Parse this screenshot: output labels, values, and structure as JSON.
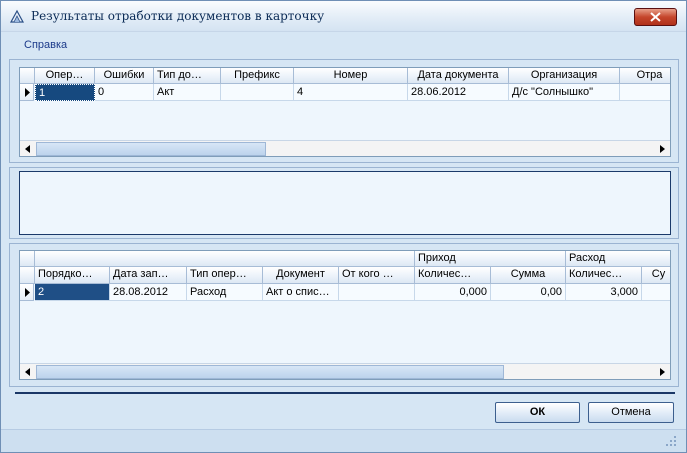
{
  "window": {
    "title": "Результаты отработки документов в карточку",
    "close_icon": "close-icon"
  },
  "menu": {
    "help": "Справка"
  },
  "top_grid": {
    "columns": [
      "Опер…",
      "Ошибки",
      "Тип до…",
      "Префикс",
      "Номер",
      "Дата документа",
      "Организация",
      "Отра"
    ],
    "rows": [
      [
        "1",
        "0",
        "Акт",
        "",
        "4",
        "28.06.2012",
        "Д/с \"Солнышко\"",
        ""
      ]
    ]
  },
  "bottom_grid": {
    "band_headers": {
      "income": "Приход",
      "expense": "Расход"
    },
    "columns": [
      "Порядко…",
      "Дата зап…",
      "Тип опер…",
      "Документ",
      "От кого …",
      "Количес…",
      "Сумма",
      "Количес…",
      "Су"
    ],
    "rows": [
      [
        "2",
        "28.08.2012",
        "Расход",
        "Акт о спис…",
        "",
        "0,000",
        "0,00",
        "3,000",
        ""
      ]
    ]
  },
  "buttons": {
    "ok": "ОК",
    "cancel": "Отмена"
  },
  "colors": {
    "accent": "#1f4f86",
    "window_bg": "#d6e6f4",
    "close": "#c5462c"
  }
}
